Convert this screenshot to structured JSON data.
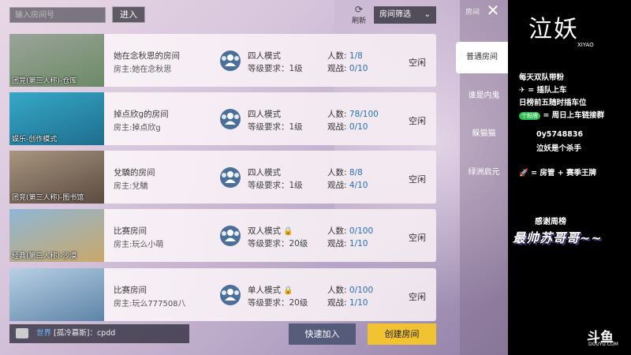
{
  "topbar": {
    "search_placeholder": "输入房间号",
    "enter_label": "进入",
    "refresh_label": "刷新",
    "filter_label": "房间筛选"
  },
  "rooms": [
    {
      "thumb_label": "团竞(第三人称)-仓库",
      "name": "她在念秋思的房间",
      "owner": "房主:她在念秋思",
      "mode": "四人模式",
      "level": "等级要求：1级",
      "players_label": "人数:",
      "players": "1/8",
      "viewers_label": "观战:",
      "viewers": "0/10",
      "status": "空闲",
      "locked": false,
      "thumb_colors": [
        "#6d8a66",
        "#9aa49a"
      ]
    },
    {
      "thumb_label": "娱乐-创作模式",
      "name": "掉点欣g的房间",
      "owner": "房主:掉点欣g",
      "mode": "四人模式",
      "level": "等级要求：1级",
      "players_label": "人数:",
      "players": "78/100",
      "viewers_label": "观战:",
      "viewers": "0/10",
      "status": "空闲",
      "locked": false,
      "thumb_colors": [
        "#1e6e8c",
        "#36a8c8"
      ]
    },
    {
      "thumb_label": "团竞(第三人称)-图书馆",
      "name": "兌驕的房间",
      "owner": "房主:兌驕",
      "mode": "四人模式",
      "level": "等级要求：1级",
      "players_label": "人数:",
      "players": "8/8",
      "viewers_label": "观战:",
      "viewers": "4/10",
      "status": "空闲",
      "locked": false,
      "thumb_colors": [
        "#5b4a40",
        "#a89680"
      ]
    },
    {
      "thumb_label": "经典(第三人称)-沙漠",
      "name": "比赛房间",
      "owner": "房主:玩么小萌",
      "mode": "双人模式",
      "level": "等级要求：20级",
      "players_label": "人数:",
      "players": "0/100",
      "viewers_label": "观战:",
      "viewers": "1/10",
      "status": "空闲",
      "locked": true,
      "thumb_colors": [
        "#c9a86a",
        "#8fb6d6"
      ]
    },
    {
      "thumb_label": "",
      "name": "比赛房间",
      "owner": "房主:玩么777508八",
      "mode": "单人模式",
      "level": "等级要求：20级",
      "players_label": "人数:",
      "players": "0/100",
      "viewers_label": "观战:",
      "viewers": "1/10",
      "status": "空闲",
      "locked": true,
      "thumb_colors": [
        "#5d84a8",
        "#b8d0e4"
      ]
    }
  ],
  "bottom": {
    "chat_channel": "世界",
    "chat_text": "[孤冷慕斯]：cpdd",
    "quick_join": "快速加入",
    "create_room": "创建房间"
  },
  "right_panel": {
    "header": "房间",
    "tabs": [
      "普通房间",
      "谁是内鬼",
      "躲猫猫",
      "绿洲启元"
    ]
  },
  "overlay": {
    "logo": "泣妖",
    "logo_sub": "XIYAO",
    "line1": "每天双队带粉",
    "line2": "✈ = 插队上车",
    "line3": "日榜前五随时插车位",
    "line4_badge": "个粉牌",
    "line4": "= 周日上车链接群",
    "line5": "0y5748836",
    "line6": "泣妖是个杀手",
    "line7": "🚀 = 房管 + 赛季王牌",
    "thanks": "感谢周榜",
    "best": "最帅苏哥哥~~",
    "douyu": "斗鱼",
    "douyu_sub": "DOUYU.COM"
  }
}
